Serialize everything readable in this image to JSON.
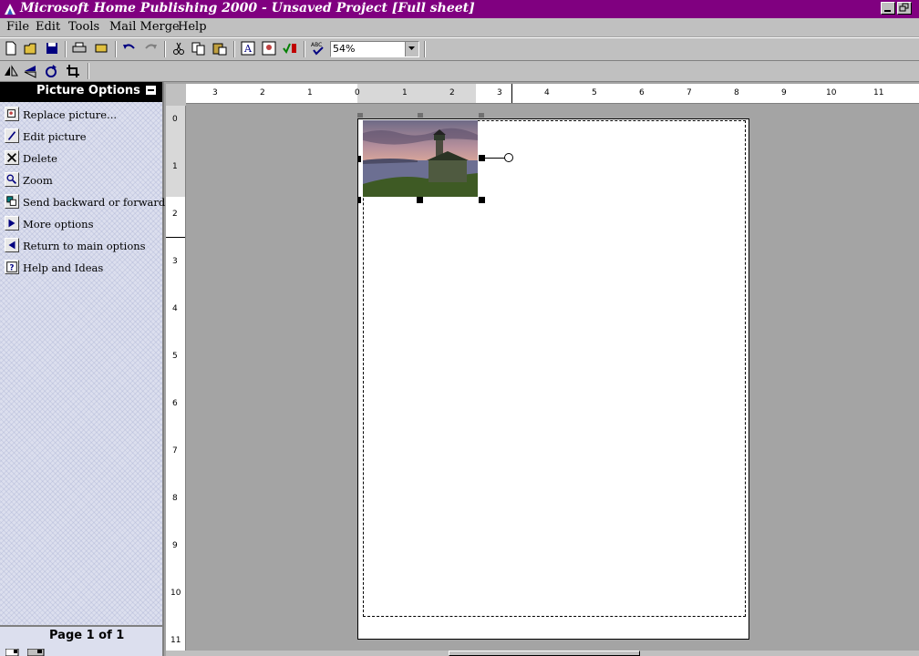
{
  "window": {
    "title": "Microsoft Home Publishing 2000 - Unsaved Project [Full sheet]"
  },
  "menu": [
    "File",
    "Edit",
    "Tools",
    "Mail Merge",
    "Help"
  ],
  "toolbar": {
    "zoom_value": "54%"
  },
  "panel": {
    "title": "Picture Options",
    "options": [
      {
        "label": "Replace picture...",
        "icon": "replace-picture-icon"
      },
      {
        "label": "Edit picture",
        "icon": "pencil-icon"
      },
      {
        "label": "Delete",
        "icon": "x-icon"
      },
      {
        "label": "Zoom",
        "icon": "magnifier-icon"
      },
      {
        "label": "Send backward or forward",
        "icon": "layers-icon"
      },
      {
        "label": "More options",
        "icon": "right-arrow-icon"
      },
      {
        "label": "Return to main options",
        "icon": "left-arrow-icon"
      },
      {
        "label": "Help and Ideas",
        "icon": "question-icon"
      }
    ],
    "page_indicator": "Page 1 of 1"
  },
  "ruler": {
    "h_labels": [
      "3",
      "2",
      "1",
      "0",
      "1",
      "2",
      "3",
      "4",
      "5",
      "6",
      "7",
      "8",
      "9",
      "10",
      "11"
    ],
    "v_labels": [
      "0",
      "1",
      "2",
      "3",
      "4",
      "5",
      "6",
      "7",
      "8",
      "9",
      "10",
      "11"
    ]
  }
}
